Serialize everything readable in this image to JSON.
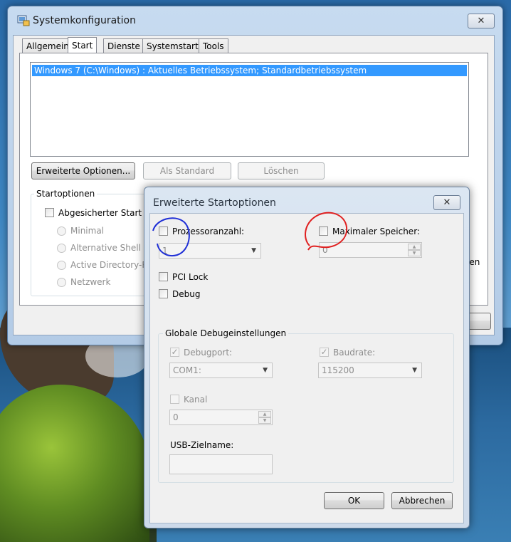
{
  "window": {
    "title": "Systemkonfiguration",
    "close_glyph": "✕",
    "tabs": [
      {
        "label": "Allgemein"
      },
      {
        "label": "Start"
      },
      {
        "label": "Dienste"
      },
      {
        "label": "Systemstart"
      },
      {
        "label": "Tools"
      }
    ],
    "boot_list": [
      "Windows 7 (C:\\Windows) : Aktuelles Betriebssystem; Standardbetriebssystem"
    ],
    "buttons": {
      "advanced": "Erweiterte Optionen...",
      "set_default": "Als Standard",
      "delete": "Löschen"
    },
    "startoptions": {
      "label": "Startoptionen",
      "safe_boot": "Abgesicherter Start",
      "minimal": "Minimal",
      "alt_shell": "Alternative Shell",
      "active_directory": "Active Directory-R",
      "network": "Netzwerk"
    },
    "partial_right_text": "len"
  },
  "dialog": {
    "title": "Erweiterte Startoptionen",
    "close_glyph": "✕",
    "processor_count": {
      "label": "Prozessoranzahl:",
      "value": "1"
    },
    "max_memory": {
      "label": "Maximaler Speicher:",
      "value": "0"
    },
    "pci_lock": "PCI Lock",
    "debug": "Debug",
    "global_debug": {
      "label": "Globale Debugeinstellungen",
      "debugport": {
        "label": "Debugport:",
        "value": "COM1:"
      },
      "baudrate": {
        "label": "Baudrate:",
        "value": "115200"
      },
      "channel": {
        "label": "Kanal",
        "value": "0"
      },
      "usb_target": {
        "label": "USB-Zielname:",
        "value": ""
      }
    },
    "ok": "OK",
    "cancel": "Abbrechen"
  },
  "colors": {
    "selection": "#3399ff",
    "annotation_blue": "#1f2fd6",
    "annotation_red": "#e02020"
  }
}
